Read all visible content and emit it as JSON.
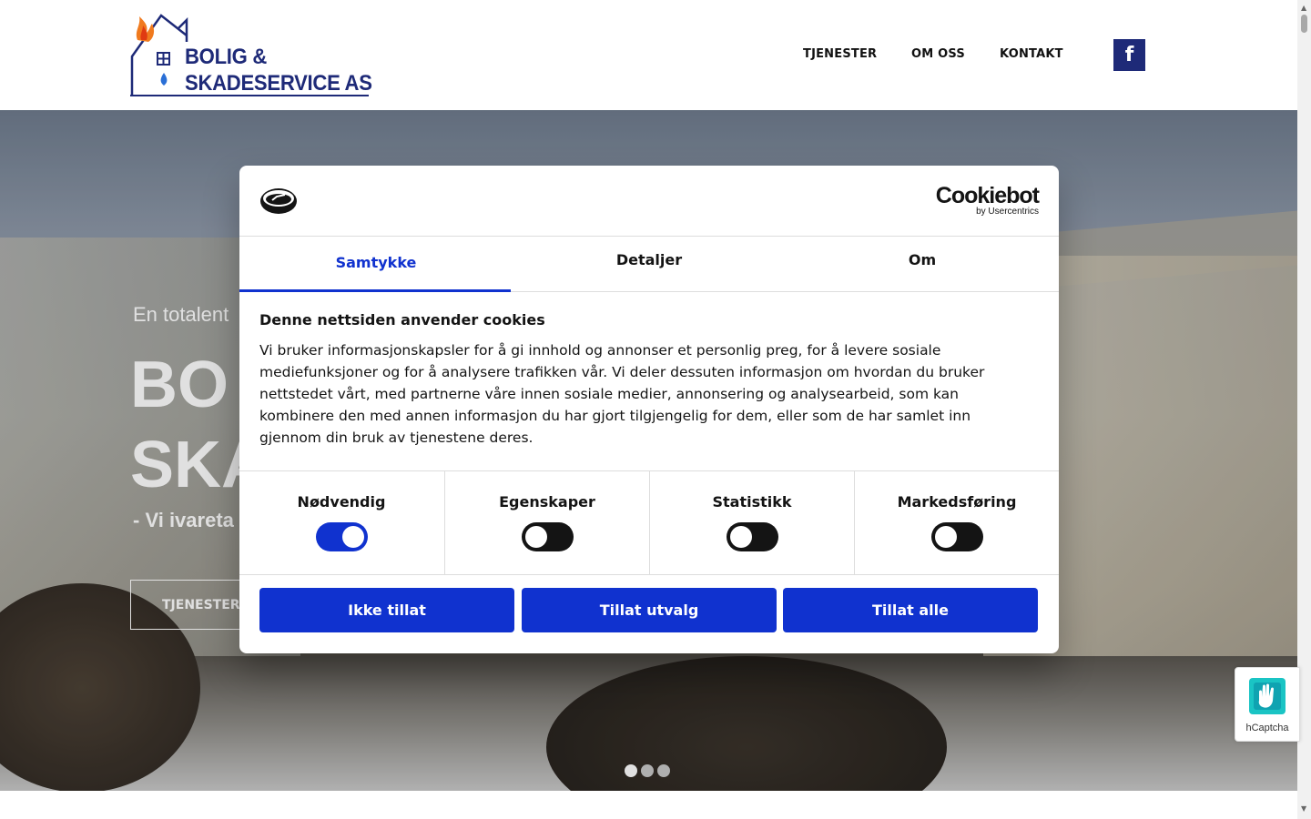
{
  "header": {
    "logo_line1": "BOLIG &",
    "logo_line2": "SKADESERVICE AS",
    "nav": [
      "TJENESTER",
      "OM OSS",
      "KONTAKT"
    ],
    "facebook_glyph": "f"
  },
  "hero": {
    "subtitle": "En totalent",
    "title_line1": "BO",
    "title_line2": "SKA",
    "tagline": "- Vi ivareta",
    "button": "TJENESTER",
    "slides": 3,
    "active_slide": 1
  },
  "cookie_dialog": {
    "brand": "Cookiebot",
    "brand_sub": "by Usercentrics",
    "tabs": [
      "Samtykke",
      "Detaljer",
      "Om"
    ],
    "active_tab": "Samtykke",
    "heading": "Denne nettsiden anvender cookies",
    "body": "Vi bruker informasjonskapsler for å gi innhold og annonser et personlig preg, for å levere sosiale mediefunksjoner og for å analysere trafikken vår. Vi deler dessuten informasjon om hvordan du bruker nettstedet vårt, med partnerne våre innen sosiale medier, annonsering og analysearbeid, som kan kombinere den med annen informasjon du har gjort tilgjengelig for dem, eller som de har samlet inn gjennom din bruk av tjenestene deres.",
    "toggles": [
      {
        "label": "Nødvendig",
        "on": true
      },
      {
        "label": "Egenskaper",
        "on": false
      },
      {
        "label": "Statistikk",
        "on": false
      },
      {
        "label": "Markedsføring",
        "on": false
      }
    ],
    "buttons": [
      "Ikke tillat",
      "Tillat utvalg",
      "Tillat alle"
    ],
    "accent_color": "#1032cf"
  },
  "hcaptcha": {
    "label": "hCaptcha"
  },
  "colors": {
    "brand_navy": "#1e2a78"
  }
}
